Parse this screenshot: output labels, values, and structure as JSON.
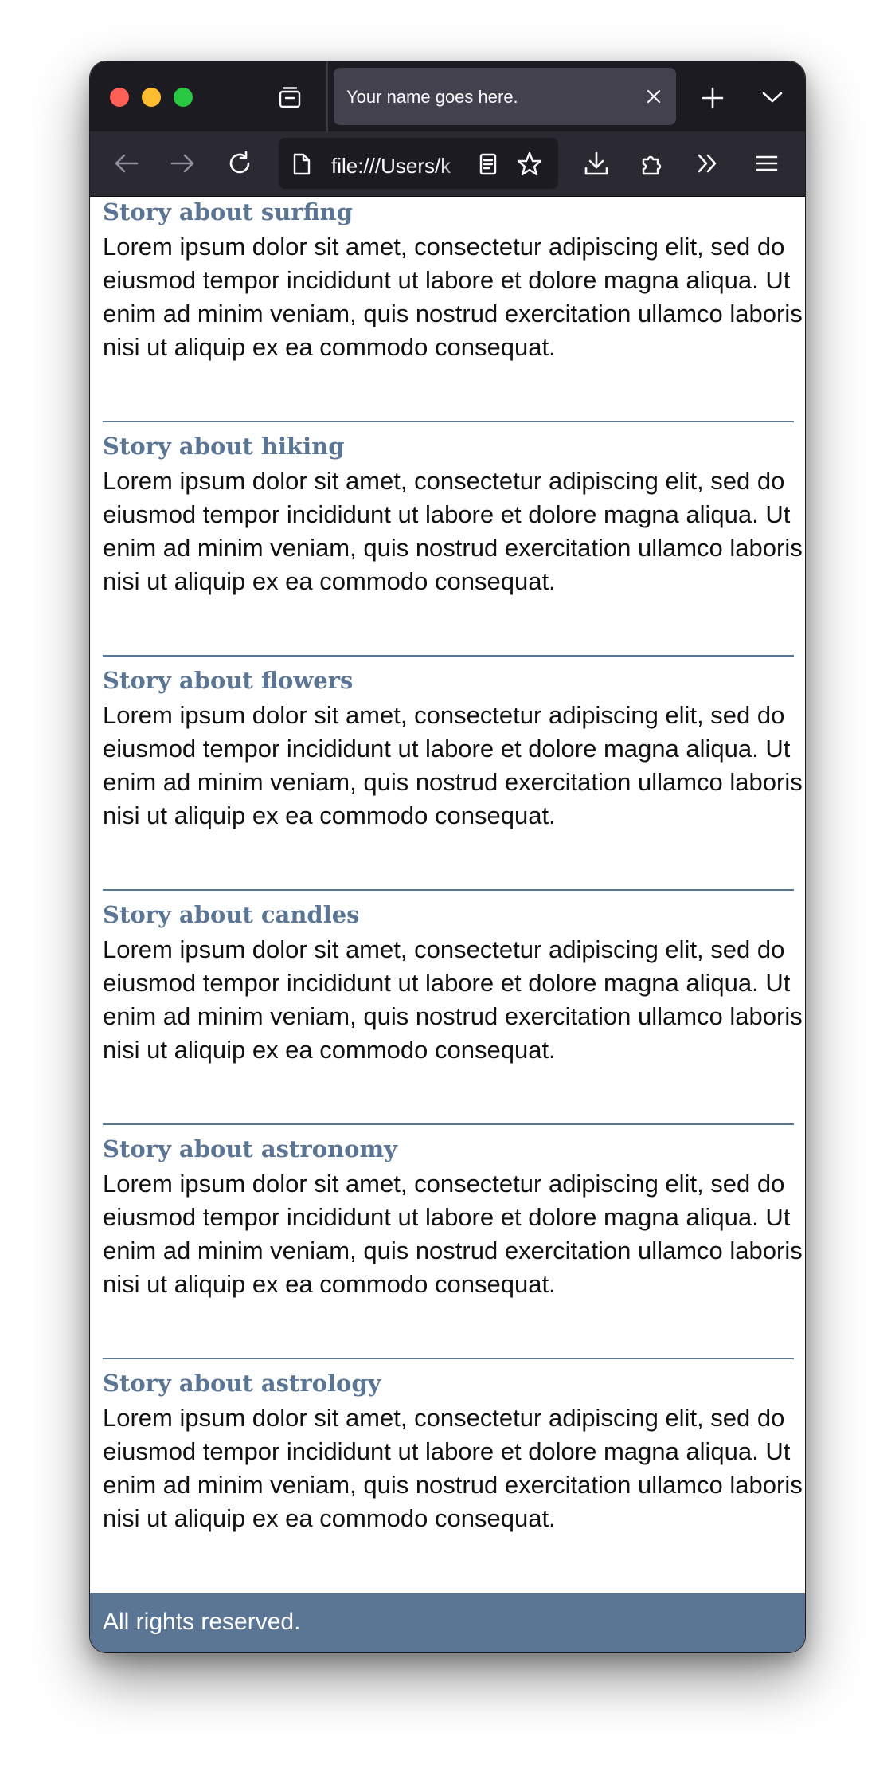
{
  "browser": {
    "tab_title": "Your name goes here.",
    "url": "file:///Users/k"
  },
  "stories": [
    {
      "title": "Story about surfing",
      "body": "Lorem ipsum dolor sit amet, consectetur adipiscing elit, sed do eiusmod tempor incididunt ut labore et dolore magna aliqua. Ut enim ad minim veniam, quis nostrud exercitation ullamco laboris nisi ut aliquip ex ea commodo consequat."
    },
    {
      "title": "Story about hiking",
      "body": "Lorem ipsum dolor sit amet, consectetur adipiscing elit, sed do eiusmod tempor incididunt ut labore et dolore magna aliqua. Ut enim ad minim veniam, quis nostrud exercitation ullamco laboris nisi ut aliquip ex ea commodo consequat."
    },
    {
      "title": "Story about flowers",
      "body": "Lorem ipsum dolor sit amet, consectetur adipiscing elit, sed do eiusmod tempor incididunt ut labore et dolore magna aliqua. Ut enim ad minim veniam, quis nostrud exercitation ullamco laboris nisi ut aliquip ex ea commodo consequat."
    },
    {
      "title": "Story about candles",
      "body": "Lorem ipsum dolor sit amet, consectetur adipiscing elit, sed do eiusmod tempor incididunt ut labore et dolore magna aliqua. Ut enim ad minim veniam, quis nostrud exercitation ullamco laboris nisi ut aliquip ex ea commodo consequat."
    },
    {
      "title": "Story about astronomy",
      "body": "Lorem ipsum dolor sit amet, consectetur adipiscing elit, sed do eiusmod tempor incididunt ut labore et dolore magna aliqua. Ut enim ad minim veniam, quis nostrud exercitation ullamco laboris nisi ut aliquip ex ea commodo consequat."
    },
    {
      "title": "Story about astrology",
      "body": "Lorem ipsum dolor sit amet, consectetur adipiscing elit, sed do eiusmod tempor incididunt ut labore et dolore magna aliqua. Ut enim ad minim veniam, quis nostrud exercitation ullamco laboris nisi ut aliquip ex ea commodo consequat."
    }
  ],
  "footer": {
    "text": "All rights reserved."
  },
  "colors": {
    "accent": "#5b7594",
    "tabbar": "#1c1b22",
    "navbar": "#2b2a33"
  },
  "icons": [
    "tabs-icon",
    "close-icon",
    "plus-icon",
    "chevron-down-icon",
    "back-arrow-icon",
    "forward-arrow-icon",
    "reload-icon",
    "page-icon",
    "reader-mode-icon",
    "star-icon",
    "download-icon",
    "extensions-icon",
    "overflow-chevrons-icon",
    "hamburger-menu-icon"
  ]
}
